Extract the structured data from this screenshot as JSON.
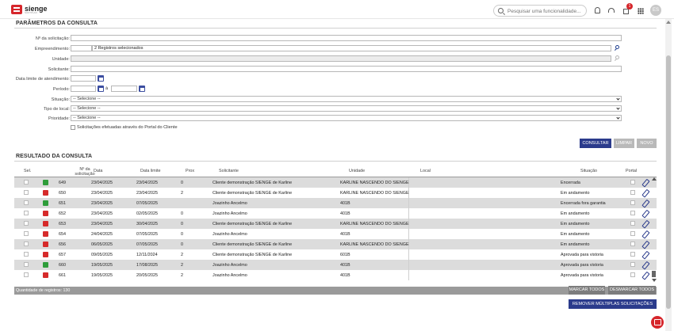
{
  "app": {
    "logo_text": "sienge",
    "logo_sub": "SOFTPLAN",
    "search_placeholder": "Pesquisar uma funcionalidade...",
    "notifications_count": "1",
    "avatar_initials": "ES"
  },
  "params": {
    "title": "PARÂMETROS DA CONSULTA",
    "labels": {
      "num_solicitacao": "Nº da solicitação:",
      "empreendimento": "Empreendimento:",
      "unidade": "Unidade:",
      "solicitante": "Solicitante:",
      "data_limite": "Data limite de atendimento:",
      "periodo": "Período:",
      "periodo_sep": "à",
      "situacao": "Situação:",
      "tipo_local": "Tipo de local:",
      "prioridade": "Prioridade:",
      "portal_checkbox": "Solicitações efetuadas através do Portal do Cliente"
    },
    "values": {
      "num_solicitacao": "",
      "empreendimento_code": "",
      "empreendimento_desc": "2 Registros selecionados",
      "unidade": "",
      "solicitante": "",
      "data_limite": "",
      "periodo_de": "",
      "periodo_ate": "",
      "situacao": "-- Selecione --",
      "tipo_local": "-- Selecione --",
      "prioridade": "-- Selecione --"
    },
    "buttons": {
      "consultar": "CONSULTAR",
      "limpar": "LIMPAR",
      "novo": "NOVO"
    }
  },
  "results": {
    "title": "RESULTADO DA CONSULTA",
    "columns": {
      "sel": "Sel.",
      "num": "Nº da solicitação",
      "data": "Data",
      "data_limite": "Data limite",
      "prox": "Prox",
      "solicitante": "Solicitante",
      "unidade": "Unidade",
      "local": "Local",
      "situacao": "Situação",
      "portal": "Portal"
    },
    "rows": [
      {
        "status": "green",
        "num": "649",
        "data": "23/04/2025",
        "limite": "23/04/2025",
        "prox": "0",
        "solicitante": "Cliente demonstração SIENGE de Karline",
        "unidade": "KARLINE NASCENDO DO SIENGE",
        "local": "",
        "situacao": "Encerrada"
      },
      {
        "status": "red",
        "num": "650",
        "data": "23/04/2025",
        "limite": "23/04/2025",
        "prox": "2",
        "solicitante": "Cliente demonstração SIENGE de Karline",
        "unidade": "KARLINE NASCENDO DO SIENGE",
        "local": "",
        "situacao": "Em andamento"
      },
      {
        "status": "green",
        "num": "651",
        "data": "23/04/2025",
        "limite": "07/05/2025",
        "prox": "",
        "solicitante": "Joazinho Ancelmo",
        "unidade": "401B",
        "local": "",
        "situacao": "Encerrada fora garantia"
      },
      {
        "status": "red",
        "num": "652",
        "data": "23/04/2025",
        "limite": "02/05/2025",
        "prox": "0",
        "solicitante": "Joazinho Ancelmo",
        "unidade": "401B",
        "local": "",
        "situacao": "Em andamento"
      },
      {
        "status": "red",
        "num": "653",
        "data": "23/04/2025",
        "limite": "30/04/2025",
        "prox": "0",
        "solicitante": "Cliente demonstração SIENGE de Karline",
        "unidade": "KARLINE NASCENDO DO SIENGE",
        "local": "",
        "situacao": "Em andamento"
      },
      {
        "status": "red",
        "num": "654",
        "data": "24/04/2025",
        "limite": "07/05/2025",
        "prox": "0",
        "solicitante": "Joazinho Ancelmo",
        "unidade": "401B",
        "local": "",
        "situacao": "Em andamento"
      },
      {
        "status": "red",
        "num": "656",
        "data": "06/05/2025",
        "limite": "07/05/2025",
        "prox": "0",
        "solicitante": "Cliente demonstração SIENGE de Karline",
        "unidade": "KARLINE NASCENDO DO SIENGE",
        "local": "",
        "situacao": "Em andamento"
      },
      {
        "status": "red",
        "num": "657",
        "data": "09/05/2025",
        "limite": "12/11/2024",
        "prox": "2",
        "solicitante": "Cliente demonstração SIENGE de Karline",
        "unidade": "601B",
        "local": "",
        "situacao": "Aprovada para vistoria"
      },
      {
        "status": "green",
        "num": "660",
        "data": "19/05/2025",
        "limite": "17/08/2025",
        "prox": "2",
        "solicitante": "Joazinho Ancelmo",
        "unidade": "401B",
        "local": "",
        "situacao": "Aprovada para vistoria"
      },
      {
        "status": "red",
        "num": "661",
        "data": "19/05/2025",
        "limite": "20/05/2025",
        "prox": "2",
        "solicitante": "Joazinho Ancelmo",
        "unidade": "401B",
        "local": "",
        "situacao": "Aprovada para vistoria"
      }
    ],
    "footer_text": "Quantidade de registros: 130",
    "marcar_todos": "MARCAR TODOS",
    "desmarcar_todos": "DESMARCAR TODOS",
    "remover": "REMOVER MÚLTIPLAS SOLICITAÇÕES"
  },
  "colors": {
    "brand_red": "#d6262b",
    "primary_blue": "#2b3b8c",
    "status_green": "#2e9d3a",
    "status_red": "#d62a2a"
  }
}
